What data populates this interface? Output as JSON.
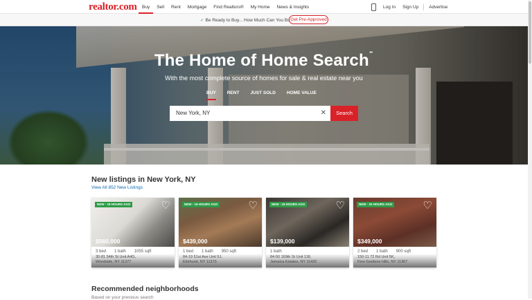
{
  "header": {
    "logo": "realtor.com",
    "logo_mark": "®",
    "nav": [
      "Buy",
      "Sell",
      "Rent",
      "Mortgage",
      "Find Realtors®",
      "My Home",
      "News & Insights"
    ],
    "active_nav": "Buy",
    "right": {
      "login": "Log In",
      "signup": "Sign Up",
      "advertise": "Advertise"
    }
  },
  "promo": {
    "text": "Be Ready to Buy... How Much Can You Borrow?",
    "button": "Get Pre-Approved"
  },
  "hero": {
    "title": "The Home of Home Search",
    "tm": "℠",
    "subtitle": "With the most complete source of homes for sale & real estate near you",
    "tabs": [
      "BUY",
      "RENT",
      "JUST SOLD",
      "HOME VALUE"
    ],
    "active_tab": "BUY",
    "search_value": "New York, NY",
    "search_button": "Search"
  },
  "listings": {
    "title": "New listings in New York, NY",
    "link": "View All 852 New Listings",
    "cards": [
      {
        "badge": "NEW - 18 HOURS AGO",
        "price": "$560,000",
        "beds": "3 bed",
        "baths": "1 bath",
        "sqft": "1055 sqft",
        "addr1": "30-81 54th St Unit A4G,",
        "addr2": "Woodside, NY 11377"
      },
      {
        "badge": "NEW - 19 HOURS AGO",
        "price": "$439,000",
        "beds": "1 bed",
        "baths": "1 bath",
        "sqft": "950 sqft",
        "addr1": "84-19 51st Ave Unit 5J,",
        "addr2": "Elmhurst, NY 11373"
      },
      {
        "badge": "NEW - 19 HOURS AGO",
        "price": "$139,000",
        "beds": "",
        "baths": "1 bath",
        "sqft": "",
        "addr1": "84-50 169th St Unit 118,",
        "addr2": "Jamaica Estates, NY 11432"
      },
      {
        "badge": "NEW - 20 HOURS AGO",
        "price": "$349,000",
        "beds": "2 bed",
        "baths": "1 bath",
        "sqft": "900 sqft",
        "addr1": "150-11 72 Rd Unit 5K,",
        "addr2": "Kew Gardens Hills, NY 11367"
      }
    ]
  },
  "recommended": {
    "title": "Recommended neighborhoods",
    "subtitle": "Based on your previous search"
  },
  "colors": {
    "brand": "#d92228",
    "badge": "#2e9b47",
    "link": "#0f6bb3"
  }
}
